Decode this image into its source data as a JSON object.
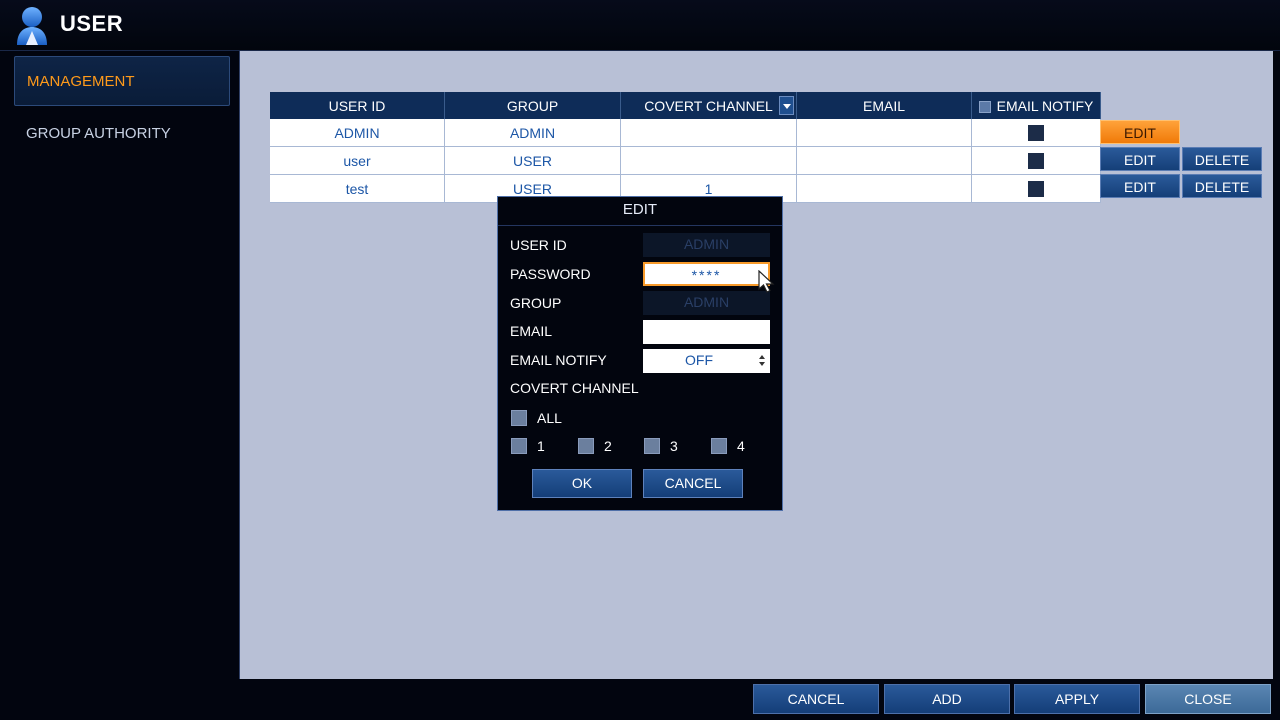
{
  "window": {
    "title": "USER",
    "icon": "user-icon"
  },
  "sidebar": {
    "items": [
      {
        "label": "MANAGEMENT",
        "active": true
      },
      {
        "label": "GROUP AUTHORITY",
        "active": false
      }
    ]
  },
  "table": {
    "headers": [
      "USER ID",
      "GROUP",
      "COVERT CHANNEL",
      "EMAIL",
      "EMAIL NOTIFY"
    ],
    "rows": [
      {
        "user_id": "ADMIN",
        "group": "ADMIN",
        "covert_channel": "",
        "email": "",
        "edit": "EDIT",
        "delete": ""
      },
      {
        "user_id": "user",
        "group": "USER",
        "covert_channel": "",
        "email": "",
        "edit": "EDIT",
        "delete": "DELETE"
      },
      {
        "user_id": "test",
        "group": "USER",
        "covert_channel": "1",
        "email": "",
        "edit": "EDIT",
        "delete": "DELETE"
      }
    ]
  },
  "dialog": {
    "title": "EDIT",
    "fields": {
      "user_id": {
        "label": "USER ID",
        "value": "ADMIN"
      },
      "password": {
        "label": "PASSWORD",
        "value": "****"
      },
      "group": {
        "label": "GROUP",
        "value": "ADMIN"
      },
      "email": {
        "label": "EMAIL",
        "value": ""
      },
      "email_notify": {
        "label": "EMAIL NOTIFY",
        "value": "OFF"
      },
      "covert_channel": {
        "label": "COVERT CHANNEL"
      }
    },
    "channels": {
      "all": "ALL",
      "items": [
        "1",
        "2",
        "3",
        "4"
      ]
    },
    "ok": "OK",
    "cancel": "CANCEL"
  },
  "footer": {
    "cancel": "CANCEL",
    "add": "ADD",
    "apply": "APPLY",
    "close": "CLOSE"
  },
  "colors": {
    "accent": "#ff9a1a",
    "panel": "#b8c0d6",
    "header": "#0e2c58",
    "text_link": "#1c56a6"
  }
}
